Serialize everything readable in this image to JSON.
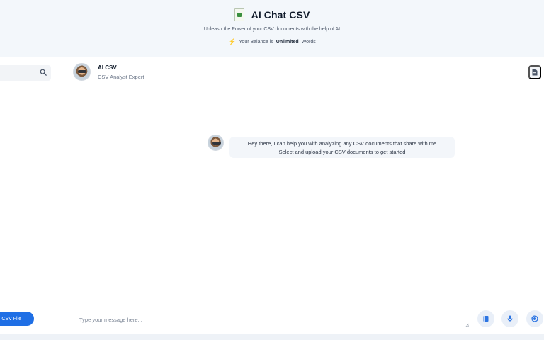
{
  "app": {
    "title": "AI Chat CSV",
    "subtitle": "Unleash the Power of your CSV documents with the help of AI",
    "balance_prefix": "Your Balance is",
    "balance_value": "Unlimited",
    "balance_suffix": "Words",
    "icon": "spreadsheet-document-icon"
  },
  "sidebar": {
    "search_icon": "search-icon"
  },
  "chat_header": {
    "name": "AI CSV",
    "role": "CSV Analyst Expert",
    "action_icon": "document-icon"
  },
  "messages": [
    {
      "sender": "AI CSV",
      "lines": [
        "Hey there, I can help you with analyzing any CSV documents that share with me",
        "Select and upload your CSV documents to get started"
      ]
    }
  ],
  "composer": {
    "upload_label": "CSV File",
    "placeholder": "Type your message here...",
    "tools": [
      "book-icon",
      "microphone-icon",
      "stop-icon"
    ]
  },
  "colors": {
    "accent": "#1f6fe5",
    "header_bg": "#f3f7fb",
    "bubble_bg": "#f3f6fa"
  }
}
